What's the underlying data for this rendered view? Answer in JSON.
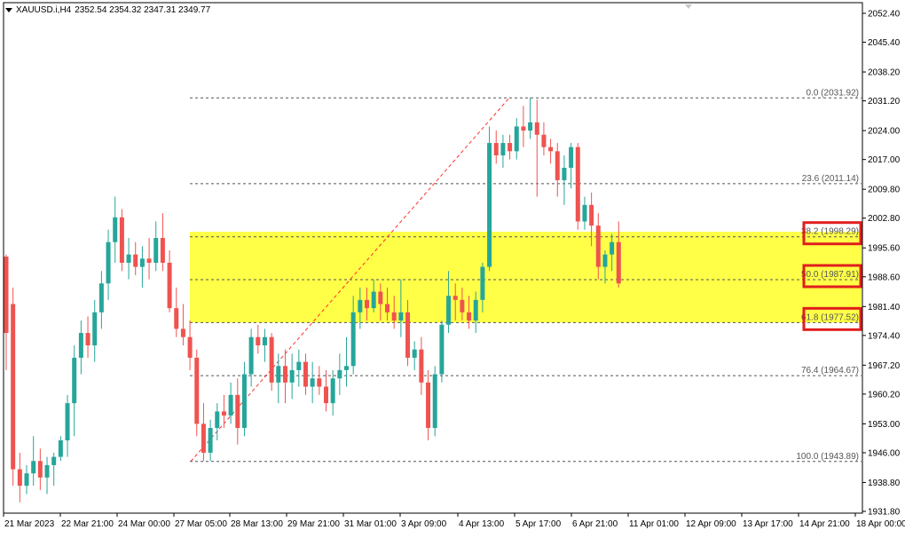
{
  "header": {
    "symbol": "XAUUSD.i,H4",
    "ohlc": "2352.54 2354.32 2347.31 2349.77"
  },
  "colors": {
    "bull": "#26a69a",
    "bear": "#ef5350",
    "zone": "#ffff00",
    "highlight_box": "#e01e1e",
    "fib_line": "#555555",
    "trend": "#ff3030"
  },
  "chart_data": {
    "type": "candlestick",
    "title": "",
    "ylim": [
      1931.8,
      2055.0
    ],
    "y_ticks": [
      "2052.40",
      "2045.40",
      "2038.20",
      "2031.20",
      "2024.00",
      "2017.00",
      "2009.80",
      "2002.80",
      "1995.60",
      "1988.60",
      "1981.40",
      "1974.40",
      "1967.20",
      "1960.20",
      "1953.00",
      "1946.00",
      "1938.80",
      "1931.80"
    ],
    "x_ticks": [
      "21 Mar 2023",
      "22 Mar 21:00",
      "24 Mar 00:00",
      "27 Mar 05:00",
      "28 Mar 13:00",
      "29 Mar 21:00",
      "31 Mar 01:00",
      "3 Apr 09:00",
      "4 Apr 13:00",
      "5 Apr 17:00",
      "6 Apr 21:00",
      "11 Apr 01:00",
      "12 Apr 09:00",
      "13 Apr 17:00",
      "14 Apr 21:00",
      "18 Apr 00:00"
    ],
    "fib_levels": [
      {
        "label": "0.0 (2031.92)",
        "value": 2031.92,
        "highlighted": false
      },
      {
        "label": "23.6 (2011.14)",
        "value": 2011.14,
        "highlighted": false
      },
      {
        "label": "38.2 (1998.29)",
        "value": 1998.29,
        "highlighted": true
      },
      {
        "label": "50.0 (1987.91)",
        "value": 1987.91,
        "highlighted": true
      },
      {
        "label": "61.8 (1977.52)",
        "value": 1977.52,
        "highlighted": true
      },
      {
        "label": "76.4 (1964.67)",
        "value": 1964.67,
        "highlighted": false
      },
      {
        "label": "100.0 (1943.89)",
        "value": 1943.89,
        "highlighted": false
      }
    ],
    "zone": {
      "from": 1977.52,
      "to": 1999.5
    },
    "trendline": {
      "from": 1943.89,
      "to": 2031.92
    },
    "candles": [
      [
        1993.5,
        1994.0,
        1966.0,
        1975.0
      ],
      [
        1982.0,
        1986.0,
        1938.0,
        1942.0
      ],
      [
        1942.0,
        1946.0,
        1934.0,
        1938.0
      ],
      [
        1938.0,
        1943.0,
        1936.0,
        1941.0
      ],
      [
        1941.0,
        1950.0,
        1938.0,
        1944.0
      ],
      [
        1944.0,
        1947.0,
        1937.0,
        1940.0
      ],
      [
        1940.0,
        1945.0,
        1936.0,
        1943.0
      ],
      [
        1943.0,
        1946.0,
        1938.0,
        1945.0
      ],
      [
        1945.0,
        1950.0,
        1944.0,
        1949.0
      ],
      [
        1949.0,
        1960.0,
        1945.0,
        1958.0
      ],
      [
        1958.0,
        1972.0,
        1950.0,
        1969.0
      ],
      [
        1969.0,
        1978.0,
        1965.0,
        1975.0
      ],
      [
        1975.0,
        1979.0,
        1969.0,
        1972.0
      ],
      [
        1972.0,
        1983.0,
        1968.0,
        1980.0
      ],
      [
        1980.0,
        1990.0,
        1976.0,
        1987.0
      ],
      [
        1987.0,
        2000.0,
        1983.0,
        1997.0
      ],
      [
        1997.0,
        2008.0,
        1992.0,
        2003.0
      ],
      [
        2003.0,
        2005.0,
        1990.0,
        1992.0
      ],
      [
        1992.0,
        1998.0,
        1988.0,
        1994.0
      ],
      [
        1994.0,
        1997.0,
        1989.0,
        1991.0
      ],
      [
        1991.0,
        1996.0,
        1986.0,
        1993.0
      ],
      [
        1993.0,
        1998.0,
        1988.0,
        1992.0
      ],
      [
        1992.0,
        2002.0,
        1990.0,
        1998.0
      ],
      [
        1998.0,
        2004.0,
        1990.0,
        1992.0
      ],
      [
        1992.0,
        1995.0,
        1980.0,
        1981.0
      ],
      [
        1981.0,
        1986.0,
        1974.0,
        1976.0
      ],
      [
        1976.0,
        1982.0,
        1972.0,
        1974.0
      ],
      [
        1974.0,
        1978.0,
        1966.0,
        1969.0
      ],
      [
        1969.0,
        1971.0,
        1950.0,
        1953.0
      ],
      [
        1953.0,
        1958.0,
        1944.0,
        1946.0
      ],
      [
        1946.0,
        1954.0,
        1944.0,
        1952.0
      ],
      [
        1952.0,
        1958.0,
        1949.0,
        1956.0
      ],
      [
        1956.0,
        1960.0,
        1952.0,
        1955.0
      ],
      [
        1955.0,
        1963.0,
        1953.0,
        1960.0
      ],
      [
        1960.0,
        1964.0,
        1948.0,
        1952.0
      ],
      [
        1952.0,
        1968.0,
        1950.0,
        1965.0
      ],
      [
        1965.0,
        1976.0,
        1962.0,
        1974.0
      ],
      [
        1974.0,
        1977.0,
        1970.0,
        1972.0
      ],
      [
        1972.0,
        1976.0,
        1968.0,
        1974.0
      ],
      [
        1974.0,
        1975.0,
        1961.0,
        1963.0
      ],
      [
        1963.0,
        1970.0,
        1958.0,
        1967.0
      ],
      [
        1967.0,
        1971.0,
        1958.0,
        1963.0
      ],
      [
        1963.0,
        1970.0,
        1959.0,
        1966.0
      ],
      [
        1966.0,
        1971.0,
        1962.0,
        1968.0
      ],
      [
        1968.0,
        1970.0,
        1960.0,
        1962.0
      ],
      [
        1962.0,
        1968.0,
        1958.0,
        1964.0
      ],
      [
        1964.0,
        1967.0,
        1960.0,
        1962.0
      ],
      [
        1962.0,
        1966.0,
        1956.0,
        1958.0
      ],
      [
        1958.0,
        1966.0,
        1955.0,
        1964.0
      ],
      [
        1964.0,
        1970.0,
        1960.0,
        1966.0
      ],
      [
        1966.0,
        1974.0,
        1962.0,
        1967.0
      ],
      [
        1967.0,
        1984.0,
        1965.0,
        1980.0
      ],
      [
        1980.0,
        1986.0,
        1976.0,
        1983.0
      ],
      [
        1983.0,
        1986.0,
        1978.0,
        1981.0
      ],
      [
        1981.0,
        1988.0,
        1980.0,
        1985.0
      ],
      [
        1985.0,
        1987.0,
        1978.0,
        1982.0
      ],
      [
        1982.0,
        1986.0,
        1978.0,
        1980.0
      ],
      [
        1980.0,
        1984.0,
        1976.0,
        1978.0
      ],
      [
        1978.0,
        1988.0,
        1974.0,
        1980.0
      ],
      [
        1980.0,
        1983.0,
        1967.0,
        1969.0
      ],
      [
        1969.0,
        1973.0,
        1966.0,
        1971.0
      ],
      [
        1971.0,
        1974.0,
        1960.0,
        1963.0
      ],
      [
        1963.0,
        1966.0,
        1949.0,
        1952.0
      ],
      [
        1952.0,
        1967.0,
        1950.0,
        1965.0
      ],
      [
        1965.0,
        1978.0,
        1963.0,
        1977.0
      ],
      [
        1977.0,
        1990.0,
        1975.0,
        1984.0
      ],
      [
        1984.0,
        1987.0,
        1978.0,
        1983.0
      ],
      [
        1983.0,
        1986.0,
        1978.0,
        1980.0
      ],
      [
        1980.0,
        1984.0,
        1976.0,
        1978.0
      ],
      [
        1978.0,
        1985.0,
        1975.0,
        1983.0
      ],
      [
        1983.0,
        1992.0,
        1980.0,
        1991.0
      ],
      [
        1991.0,
        2025.0,
        1990.0,
        2021.0
      ],
      [
        2021.0,
        2024.0,
        2016.0,
        2018.0
      ],
      [
        2018.0,
        2023.0,
        2015.0,
        2021.0
      ],
      [
        2021.0,
        2023.0,
        2017.0,
        2019.0
      ],
      [
        2019.0,
        2027.0,
        2017.0,
        2025.0
      ],
      [
        2025.0,
        2030.0,
        2020.0,
        2024.0
      ],
      [
        2024.0,
        2032.0,
        2022.0,
        2026.0
      ],
      [
        2026.0,
        2031.5,
        2008.0,
        2023.0
      ],
      [
        2023.0,
        2026.0,
        2018.0,
        2020.0
      ],
      [
        2020.0,
        2022.0,
        2016.0,
        2019.0
      ],
      [
        2019.0,
        2021.0,
        2008.0,
        2012.0
      ],
      [
        2012.0,
        2018.0,
        2006.0,
        2015.0
      ],
      [
        2015.0,
        2021.0,
        2010.0,
        2020.0
      ],
      [
        2020.0,
        2021.0,
        2000.0,
        2002.0
      ],
      [
        2002.0,
        2008.0,
        2000.0,
        2006.0
      ],
      [
        2006.0,
        2009.0,
        1996.0,
        2001.0
      ],
      [
        2001.0,
        2004.0,
        1988.0,
        1991.0
      ],
      [
        1991.0,
        1995.0,
        1987.0,
        1994.0
      ],
      [
        1994.0,
        1999.0,
        1990.0,
        1997.0
      ],
      [
        1997.0,
        2002.0,
        1986.0,
        1987.0
      ]
    ]
  }
}
